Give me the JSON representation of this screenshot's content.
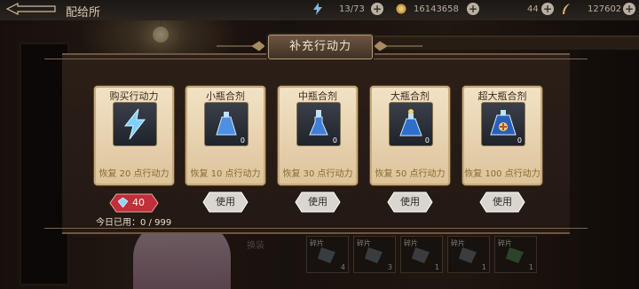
{
  "topbar": {
    "title": "配给所",
    "stamina": "13/73",
    "gold": "16143658",
    "gems": "44",
    "currency4": "127602"
  },
  "background": {
    "change_label": "换装",
    "shards": [
      {
        "tag": "碎片",
        "count": "4"
      },
      {
        "tag": "碎片",
        "count": "3"
      },
      {
        "tag": "碎片",
        "count": "1"
      },
      {
        "tag": "碎片",
        "count": "1"
      },
      {
        "tag": "碎片",
        "count": "1"
      }
    ]
  },
  "dialog": {
    "title": "补充行动力",
    "cards": [
      {
        "name": "购买行动力",
        "icon": "lightning-icon",
        "count": "",
        "effect": "恢复 20 点行动力"
      },
      {
        "name": "小瓶合剂",
        "icon": "small-potion-icon",
        "count": "0",
        "effect": "恢复 10 点行动力"
      },
      {
        "name": "中瓶合剂",
        "icon": "medium-potion-icon",
        "count": "0",
        "effect": "恢复 30 点行动力"
      },
      {
        "name": "大瓶合剂",
        "icon": "large-potion-icon",
        "count": "0",
        "effect": "恢复 50 点行动力"
      },
      {
        "name": "超大瓶合剂",
        "icon": "extra-large-potion-icon",
        "count": "0",
        "effect": "恢复 100 点行动力"
      }
    ],
    "buy_price": "40",
    "use_label": "使用",
    "daily_used": "今日已用：0 / 999"
  },
  "colors": {
    "card_bg": "#ecd9b4",
    "effect_text": "#8a6a2e",
    "buy_button": "#c0303a",
    "use_button": "#d9d6d0"
  }
}
